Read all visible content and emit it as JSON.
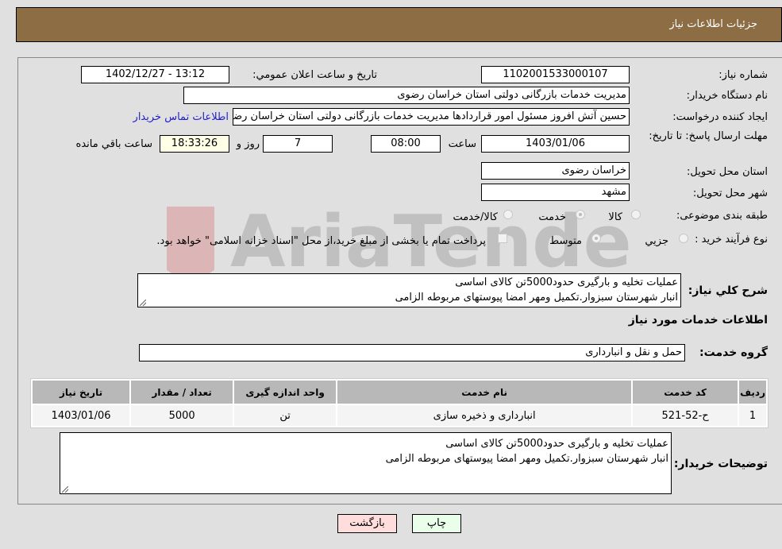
{
  "header": {
    "title": "جزئیات اطلاعات نیاز"
  },
  "form": {
    "need_number": {
      "label": "شماره نیاز:",
      "value": "1102001533000107"
    },
    "announce_datetime": {
      "label": "تاریخ و ساعت اعلان عمومي:",
      "value": "1402/12/27 - 13:12"
    },
    "buyer_org": {
      "label": "نام دستگاه خریدار:",
      "value": "مدیریت خدمات بازرگانی دولتی استان خراسان رضوی"
    },
    "requester": {
      "label": "ایجاد کننده درخواست:",
      "value": "حسین آتش افروز مسئول امور قراردادها مدیریت خدمات بازرگانی دولتی استان خراسان رضوی",
      "contact_link": "اطلاعات تماس خریدار"
    },
    "deadline": {
      "label": "مهلت ارسال پاسخ: تا تاریخ:",
      "date": "1403/01/06",
      "time_label": "ساعت",
      "time": "08:00",
      "days": "7",
      "days_label": "روز و",
      "remaining": "18:33:26",
      "remaining_label": "ساعت باقي مانده"
    },
    "delivery_province": {
      "label": "استان محل تحویل:",
      "value": "خراسان رضوی"
    },
    "delivery_city": {
      "label": "شهر محل تحویل:",
      "value": "مشهد"
    },
    "category": {
      "label": "طبقه بندی موضوعی:",
      "options": [
        "کالا",
        "خدمت",
        "کالا/خدمت"
      ],
      "selected": "خدمت"
    },
    "purchase_type": {
      "label": "نوع فرآیند خرید :",
      "options": [
        "جزيي",
        "متوسط"
      ],
      "selected": "متوسط",
      "treasury_note": "پرداخت تمام یا بخشی از مبلغ خرید،از محل \"اسناد خزانه اسلامی\" خواهد بود."
    },
    "description": {
      "label": "شرح کلي نیاز:",
      "lines": [
        "عملیات تخلیه و بارگیری حدود5000تن کالای اساسی",
        "انبار شهرستان سبزوار.تکمیل ومهر امضا پیوستهای مربوطه الزامی"
      ]
    }
  },
  "services": {
    "section_title": "اطلاعات خدمات مورد نیاز",
    "group_label": "گروه خدمت:",
    "group_value": "حمل و نقل و انبارداری",
    "table": {
      "headers": [
        "ردیف",
        "کد خدمت",
        "نام خدمت",
        "واحد اندازه گیری",
        "تعداد / مقدار",
        "تاریخ نیاز"
      ],
      "rows": [
        [
          "1",
          "ح-52-521",
          "انبارداری و ذخیره سازی",
          "تن",
          "5000",
          "1403/01/06"
        ]
      ]
    }
  },
  "buyer_notes": {
    "label": "توضیحات خریدار:",
    "lines": [
      "عملیات تخلیه و بارگیری حدود5000تن کالای اساسی",
      "انبار شهرستان سبزوار.تکمیل ومهر امضا پیوستهای مربوطه الزامی"
    ]
  },
  "buttons": {
    "print": "چاپ",
    "back": "بازگشت"
  },
  "colors": {
    "header_bg": "#8c6d44",
    "print_bg": "#eaffea",
    "back_bg": "#ffdddd",
    "link": "#2020cc"
  }
}
